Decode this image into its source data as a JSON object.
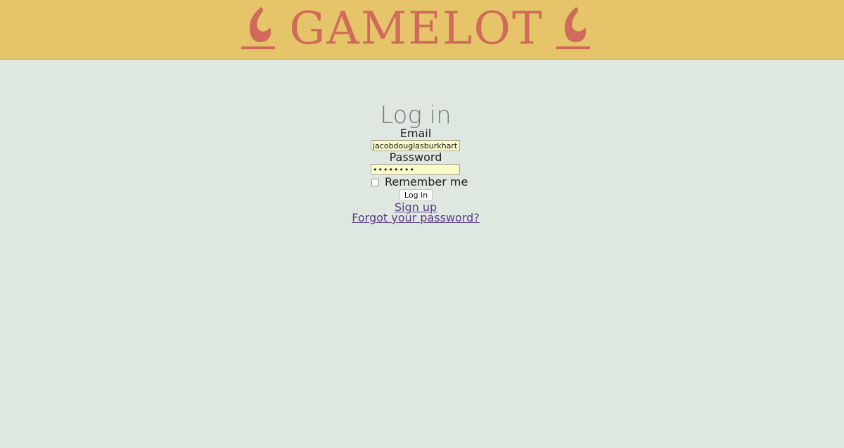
{
  "header": {
    "title": "GAMELOT",
    "accent_color": "#d06a5a",
    "background_color": "#e6c46a",
    "left_icon": "flame-icon",
    "right_icon": "flame-icon"
  },
  "login": {
    "title": "Log in",
    "email_label": "Email",
    "email_value": "jacobdouglasburkhart@",
    "password_label": "Password",
    "password_value": "••••••••",
    "remember_label": "Remember me",
    "remember_checked": false,
    "submit_label": "Log in",
    "signup_link": "Sign up",
    "forgot_link": "Forgot your password?"
  }
}
